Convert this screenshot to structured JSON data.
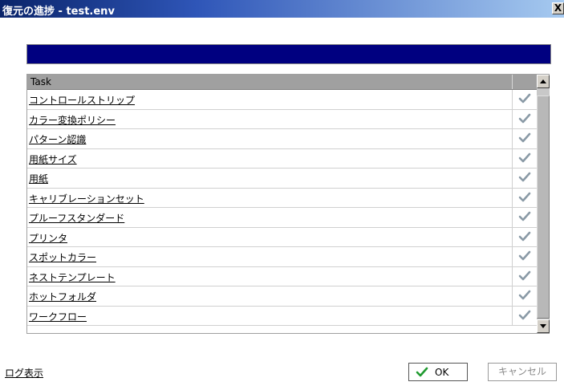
{
  "window": {
    "title": "復元の進捗 - test.env",
    "close_label": "X"
  },
  "progress": {
    "fraction": 1.0,
    "color": "#000080"
  },
  "table": {
    "column_task": "Task",
    "rows": [
      {
        "label": "コントロールストリップ",
        "status": "check"
      },
      {
        "label": "カラー変換ポリシー",
        "status": "check"
      },
      {
        "label": "パターン認識",
        "status": "check"
      },
      {
        "label": "用紙サイズ",
        "status": "check"
      },
      {
        "label": "用紙",
        "status": "check"
      },
      {
        "label": "キャリブレーションセット",
        "status": "check"
      },
      {
        "label": "プルーフスタンダード",
        "status": "check"
      },
      {
        "label": "プリンタ",
        "status": "check"
      },
      {
        "label": "スポットカラー",
        "status": "check"
      },
      {
        "label": "ネストテンプレート",
        "status": "check"
      },
      {
        "label": "ホットフォルダ",
        "status": "check"
      },
      {
        "label": "ワークフロー",
        "status": "check"
      }
    ]
  },
  "footer": {
    "log_link": "ログ表示",
    "ok_label": "OK",
    "cancel_label": "キャンセル"
  },
  "colors": {
    "check": "#8a9aa6",
    "ok_check": "#1f9a2f"
  }
}
